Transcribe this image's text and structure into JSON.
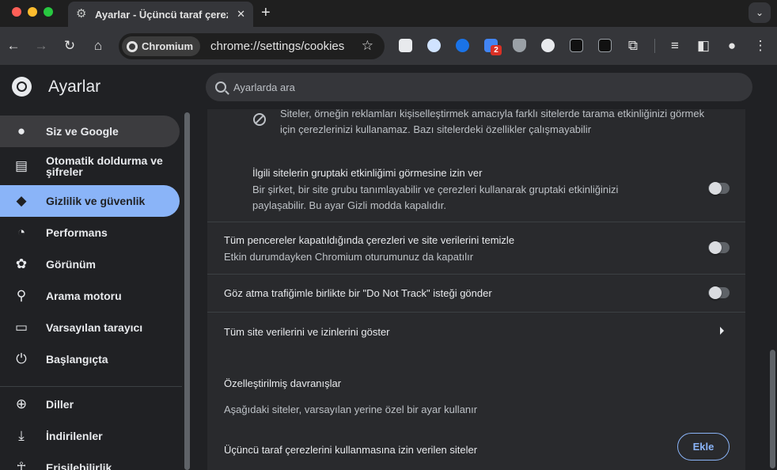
{
  "window": {
    "tab_title": "Ayarlar - Üçüncü taraf çerezleri",
    "new_tab_glyph": "+",
    "tab_close_glyph": "✕",
    "tab_search_glyph": "⌄"
  },
  "toolbar": {
    "chip_label": "Chromium",
    "url": "chrome://settings/cookies",
    "extension_badge": "2",
    "icons": [
      "back-icon",
      "forward-icon",
      "reload-icon",
      "home-icon",
      "star-icon",
      "puzzle-icon",
      "reading-list-icon",
      "side-panel-icon",
      "profile-icon",
      "menu-icon"
    ]
  },
  "header": {
    "title": "Ayarlar",
    "search_placeholder": "Ayarlarda ara"
  },
  "sidebar": {
    "items": [
      {
        "label": "Siz ve Google",
        "icon": "person-icon",
        "state": "hover"
      },
      {
        "label": "Otomatik doldurma ve şifreler",
        "icon": "clipboard-icon",
        "state": ""
      },
      {
        "label": "Gizlilik ve güvenlik",
        "icon": "shield-icon",
        "state": "selected"
      },
      {
        "label": "Performans",
        "icon": "gauge-icon",
        "state": ""
      },
      {
        "label": "Görünüm",
        "icon": "palette-icon",
        "state": ""
      },
      {
        "label": "Arama motoru",
        "icon": "search-icon",
        "state": ""
      },
      {
        "label": "Varsayılan tarayıcı",
        "icon": "browser-icon",
        "state": ""
      },
      {
        "label": "Başlangıçta",
        "icon": "power-icon",
        "state": ""
      },
      {
        "label": "Diller",
        "icon": "globe-icon",
        "state": ""
      },
      {
        "label": "İndirilenler",
        "icon": "download-icon",
        "state": ""
      },
      {
        "label": "Erişilebilirlik",
        "icon": "accessibility-icon",
        "state": ""
      }
    ]
  },
  "main": {
    "block_line1": "Siteler, örneğin reklamları kişiselleştirmek amacıyla farklı sitelerde tarama etkinliğinizi görmek",
    "block_line2": "için çerezlerinizi kullanamaz. Bazı sitelerdeki özellikler çalışmayabilir",
    "related": {
      "title": "İlgili sitelerin gruptaki etkinliğimi görmesine izin ver",
      "desc_line1": "Bir şirket, bir site grubu tanımlayabilir ve çerezleri kullanarak gruptaki etkinliğinizi",
      "desc_line2": "paylaşabilir. Bu ayar Gizli modda kapalıdır.",
      "enabled": false
    },
    "clear_on_exit": {
      "title": "Tüm pencereler kapatıldığında çerezleri ve site verilerini temizle",
      "desc": "Etkin durumdayken Chromium oturumunuz da kapatılır",
      "enabled": false
    },
    "do_not_track": {
      "title": "Göz atma trafiğimle birlikte bir \"Do Not Track\" isteği gönder",
      "enabled": false
    },
    "all_site_data": {
      "title": "Tüm site verilerini ve izinlerini göster"
    },
    "custom_behaviors": {
      "heading": "Özelleştirilmiş davranışlar",
      "desc": "Aşağıdaki siteler, varsayılan yerine özel bir ayar kullanır",
      "allowed_label": "Üçüncü taraf çerezlerini kullanmasına izin verilen siteler",
      "add_label": "Ekle"
    }
  },
  "colors": {
    "accent": "#8ab4f8",
    "background": "#202124",
    "card": "#292a2d"
  }
}
